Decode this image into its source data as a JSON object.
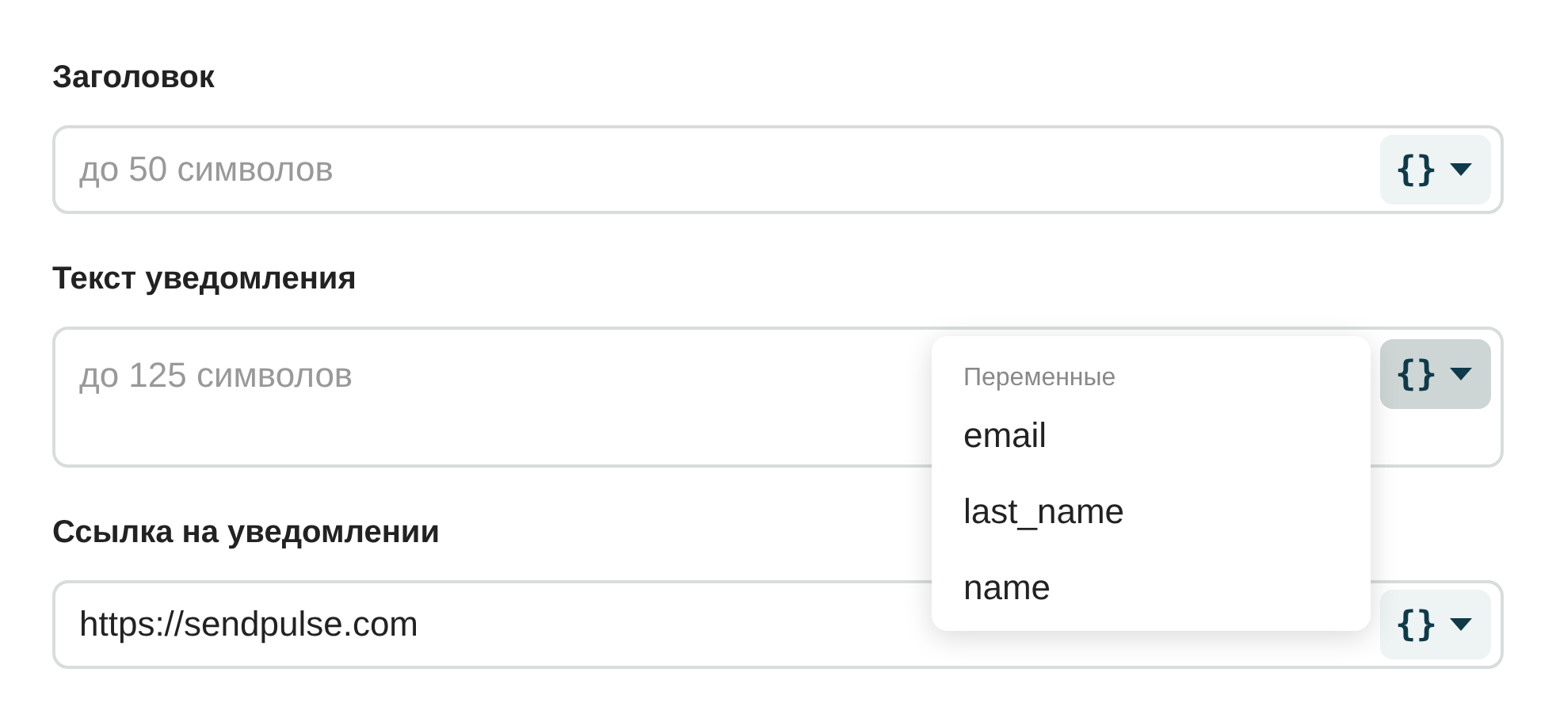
{
  "fields": [
    {
      "label": "Заголовок",
      "kind": "input",
      "placeholder": "до 50 символов",
      "variables_button": {
        "label": "{}",
        "expanded": false
      }
    },
    {
      "label": "Текст уведомления",
      "kind": "textarea",
      "placeholder": "до 125 символов",
      "variables_button": {
        "label": "{}",
        "expanded": true
      },
      "menu": {
        "header": "Переменные",
        "items": [
          "email",
          "last_name",
          "name"
        ]
      }
    },
    {
      "label": "Ссылка на уведомлении",
      "kind": "input",
      "value": "https://sendpulse.com",
      "variables_button": {
        "label": "{}",
        "expanded": false
      }
    }
  ]
}
